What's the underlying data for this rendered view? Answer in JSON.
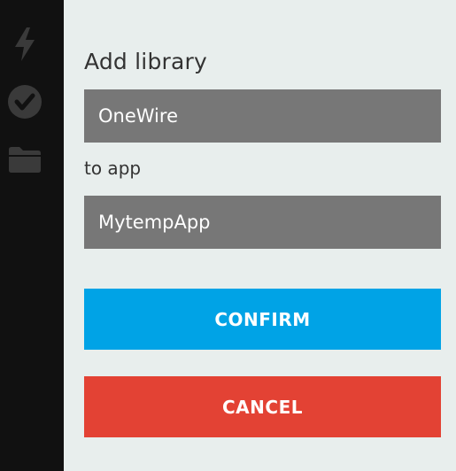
{
  "sidebar": {
    "icons": [
      "bolt-icon",
      "check-circle-icon",
      "folder-icon"
    ],
    "icon_color": "#3a3a3a"
  },
  "dialog": {
    "heading": "Add library",
    "library_value": "OneWire",
    "connector_text": "to app",
    "app_value": "MytempApp",
    "confirm_label": "CONFIRM",
    "cancel_label": "CANCEL"
  },
  "colors": {
    "sidebar_bg": "#111111",
    "panel_bg": "#e8eeed",
    "field_bg": "#777777",
    "confirm": "#00a3e6",
    "cancel": "#e34234"
  }
}
